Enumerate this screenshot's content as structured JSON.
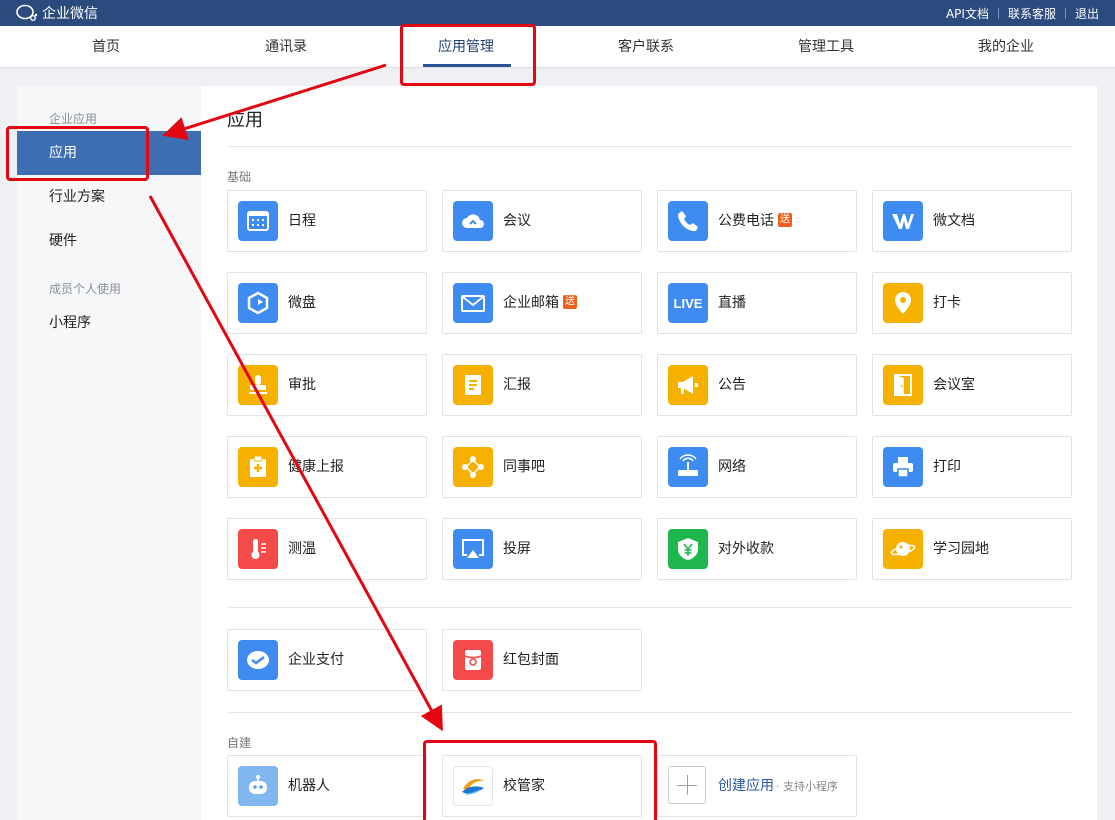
{
  "topbar": {
    "brand": "企业微信",
    "links": [
      "API文档",
      "联系客服",
      "退出"
    ]
  },
  "nav": {
    "items": [
      "首页",
      "通讯录",
      "应用管理",
      "客户联系",
      "管理工具",
      "我的企业"
    ],
    "active_index": 2
  },
  "sidebar": {
    "group1": "企业应用",
    "items1": [
      "应用",
      "行业方案",
      "硬件"
    ],
    "group2": "成员个人使用",
    "items2": [
      "小程序"
    ],
    "active": "应用"
  },
  "main": {
    "title": "应用",
    "section_basic": "基础",
    "section_custom": "自建",
    "badge_text": "送",
    "apps_basic": [
      {
        "label": "日程",
        "icon": "calendar-icon",
        "color": "#3e8cf2"
      },
      {
        "label": "会议",
        "icon": "cloud-meeting-icon",
        "color": "#3e8cf2"
      },
      {
        "label": "公费电话",
        "icon": "phone-icon",
        "color": "#3e8cf2",
        "badge": true
      },
      {
        "label": "微文档",
        "icon": "w-doc-icon",
        "color": "#3e8cf2"
      },
      {
        "label": "微盘",
        "icon": "drive-icon",
        "color": "#3e8cf2"
      },
      {
        "label": "企业邮箱",
        "icon": "mail-icon",
        "color": "#3e8cf2",
        "badge": true
      },
      {
        "label": "直播",
        "icon": "live-icon",
        "color": "#3e8cf2",
        "icon_text": "LIVE"
      },
      {
        "label": "打卡",
        "icon": "location-pin-icon",
        "color": "#f6b100"
      },
      {
        "label": "审批",
        "icon": "stamp-icon",
        "color": "#f6b100"
      },
      {
        "label": "汇报",
        "icon": "report-icon",
        "color": "#f6b100"
      },
      {
        "label": "公告",
        "icon": "megaphone-icon",
        "color": "#f6b100"
      },
      {
        "label": "会议室",
        "icon": "door-icon",
        "color": "#f6b100"
      },
      {
        "label": "健康上报",
        "icon": "health-clipboard-icon",
        "color": "#f6b100"
      },
      {
        "label": "同事吧",
        "icon": "share-nodes-icon",
        "color": "#f6b100"
      },
      {
        "label": "网络",
        "icon": "router-icon",
        "color": "#3e8cf2"
      },
      {
        "label": "打印",
        "icon": "printer-icon",
        "color": "#3e8cf2"
      },
      {
        "label": "测温",
        "icon": "thermometer-icon",
        "color": "#f54a4a"
      },
      {
        "label": "投屏",
        "icon": "airplay-icon",
        "color": "#3e8cf2"
      },
      {
        "label": "对外收款",
        "icon": "yuan-shield-icon",
        "color": "#1fb64d"
      },
      {
        "label": "学习园地",
        "icon": "planet-icon",
        "color": "#f6b100"
      }
    ],
    "apps_extra": [
      {
        "label": "企业支付",
        "icon": "pay-check-icon",
        "color": "#3e8cf2"
      },
      {
        "label": "红包封面",
        "icon": "red-envelope-icon",
        "color": "#f54a4a"
      }
    ],
    "apps_custom": [
      {
        "label": "机器人",
        "icon": "robot-icon",
        "color": "#7fb7ee"
      },
      {
        "label": "校管家",
        "icon": "school-logo-icon",
        "color": "#ffffff"
      }
    ],
    "create": {
      "label": "创建应用",
      "sub": "· 支持小程序"
    }
  }
}
